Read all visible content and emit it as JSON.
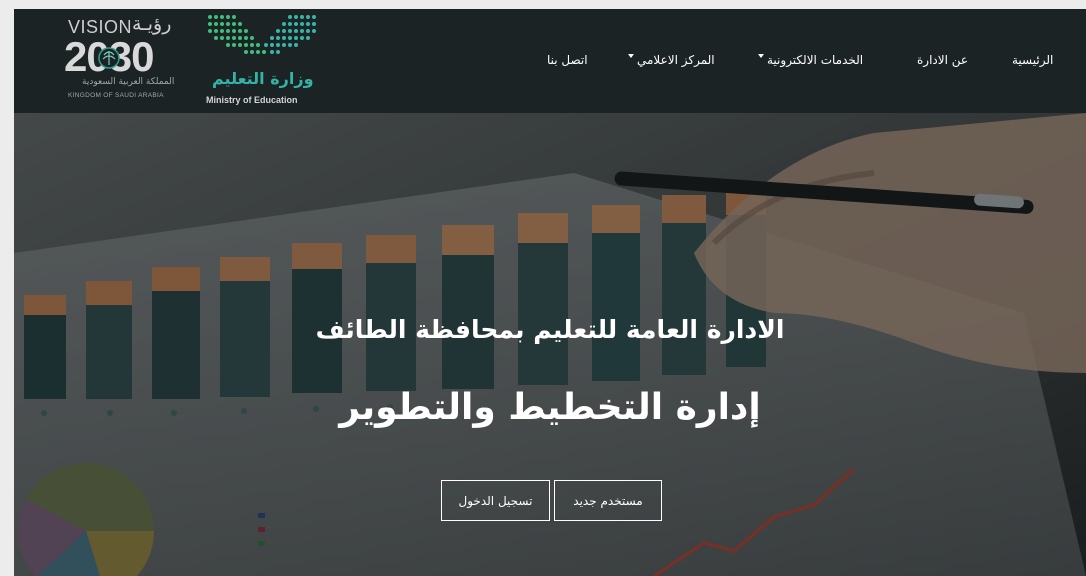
{
  "navbar": {
    "vision_logo": {
      "vision_text": "VISION",
      "vision_ar": "رؤيـة",
      "year": "2030",
      "kingdom_ar": "المملكة العربية السعودية",
      "kingdom_en": "KINGDOM OF SAUDI ARABIA"
    },
    "ministry_logo": {
      "name_ar": "وزارة التعليم",
      "name_en": "Ministry of Education"
    },
    "menu": {
      "home": "الرئيسية",
      "about": "عن الادارة",
      "eservices": "الخدمات الالكترونية",
      "media_center": "المركز الاعلامي",
      "contact": "اتصل بنا"
    }
  },
  "hero": {
    "subtitle": "الادارة العامة للتعليم بمحافظة الطائف",
    "title": "إدارة التخطيط والتطوير",
    "buttons": {
      "login": "تسجيل الدخول",
      "new_user": "مستخدم جديد"
    }
  },
  "colors": {
    "navbar_bg": "#1b2325",
    "moe_teal": "#32b3a5",
    "text_white": "#ffffff"
  },
  "icons": {
    "dropdown": "caret-down-icon"
  }
}
